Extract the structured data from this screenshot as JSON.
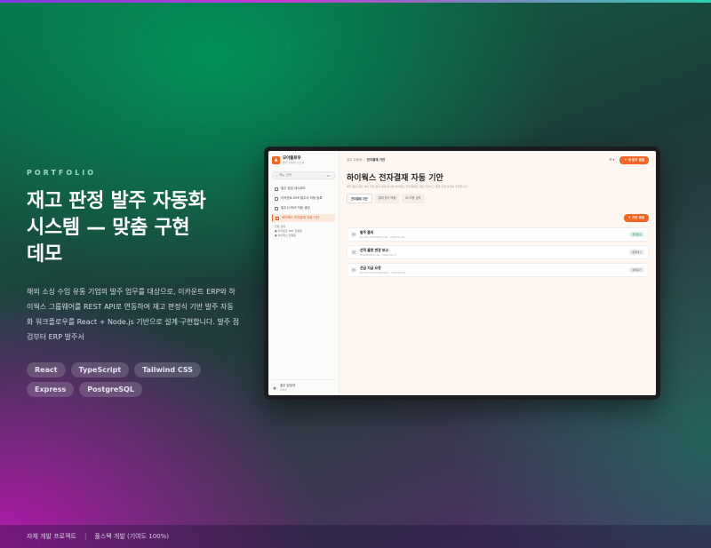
{
  "hero": {
    "eyebrow": "PORTFOLIO",
    "title": "재고 판정 발주 자동화\n시스템 — 맞춤 구현\n데모",
    "description": "해외 소싱 수입 유통 기업의 발주 업무를 대상으로, 이카운트 ERP와 하이웍스 그룹웨어를 REST API로 연동하여 재고 판정식 기반 발주 자동화 워크플로우를 React + Node.js 기반으로 설계·구현합니다. 발주 점검부터 ERP 발주서",
    "tags": [
      "React",
      "TypeScript",
      "Tailwind CSS",
      "Express",
      "PostgreSQL"
    ]
  },
  "footer": {
    "left": "자체 개발 프로젝트",
    "right": "풀스택 개발 (기여도 100%)"
  },
  "app": {
    "brand_name": "모아플로우",
    "brand_sub": "발주 자동화 시스템",
    "search_placeholder": "메뉴 검색",
    "search_kbd": "⌘K",
    "nav": [
      {
        "label": "발주 점검 대시보드"
      },
      {
        "label": "이카운트 ERP 발주서 자동 등록"
      },
      {
        "label": "발주서 PDF 자동 생성"
      },
      {
        "label": "하이웍스 전자결재 자동 기안"
      }
    ],
    "sub_title": "연동 상태",
    "sub_items": [
      "이카운트 ERP 연결됨",
      "하이웍스 연결됨"
    ],
    "user_name": "발주 담당자",
    "user_role": "관리자",
    "breadcrumb_root": "발주 자동화",
    "breadcrumb_current": "전자결재 기안",
    "mode_label": "☰ ▾",
    "new_button": "+ 새 발주 점검",
    "page_title": "하이웍스 전자결재 자동 기안",
    "page_desc": "발주 품의·법인 경비 지급 품의 결재 문서를 하이웍스 전자결재로 자동 기안하고 결재 진행 상태를 추적합니다.",
    "tabs": [
      "전자결재 기안",
      "결재 양식 매핑",
      "ID 자동 입력"
    ],
    "add_button": "+ 기안 생성",
    "docs": [
      {
        "title": "발주 품의",
        "meta": "PO-HW-20250926-001 · 2025.09.26",
        "status": "결재완료",
        "ok": true
      },
      {
        "title": "선적 물량 변경 보고",
        "meta": "PI-20250927-01 · 2025.09.27",
        "status": "결재대기",
        "ok": false
      },
      {
        "title": "선금 지급 요청",
        "meta": "PO-OUT-20250928-019 · 2025.09.28",
        "status": "결재대기",
        "ok": false
      }
    ]
  },
  "colors": {
    "accent": "#f26522",
    "eyebrow": "#9fd9c2"
  }
}
